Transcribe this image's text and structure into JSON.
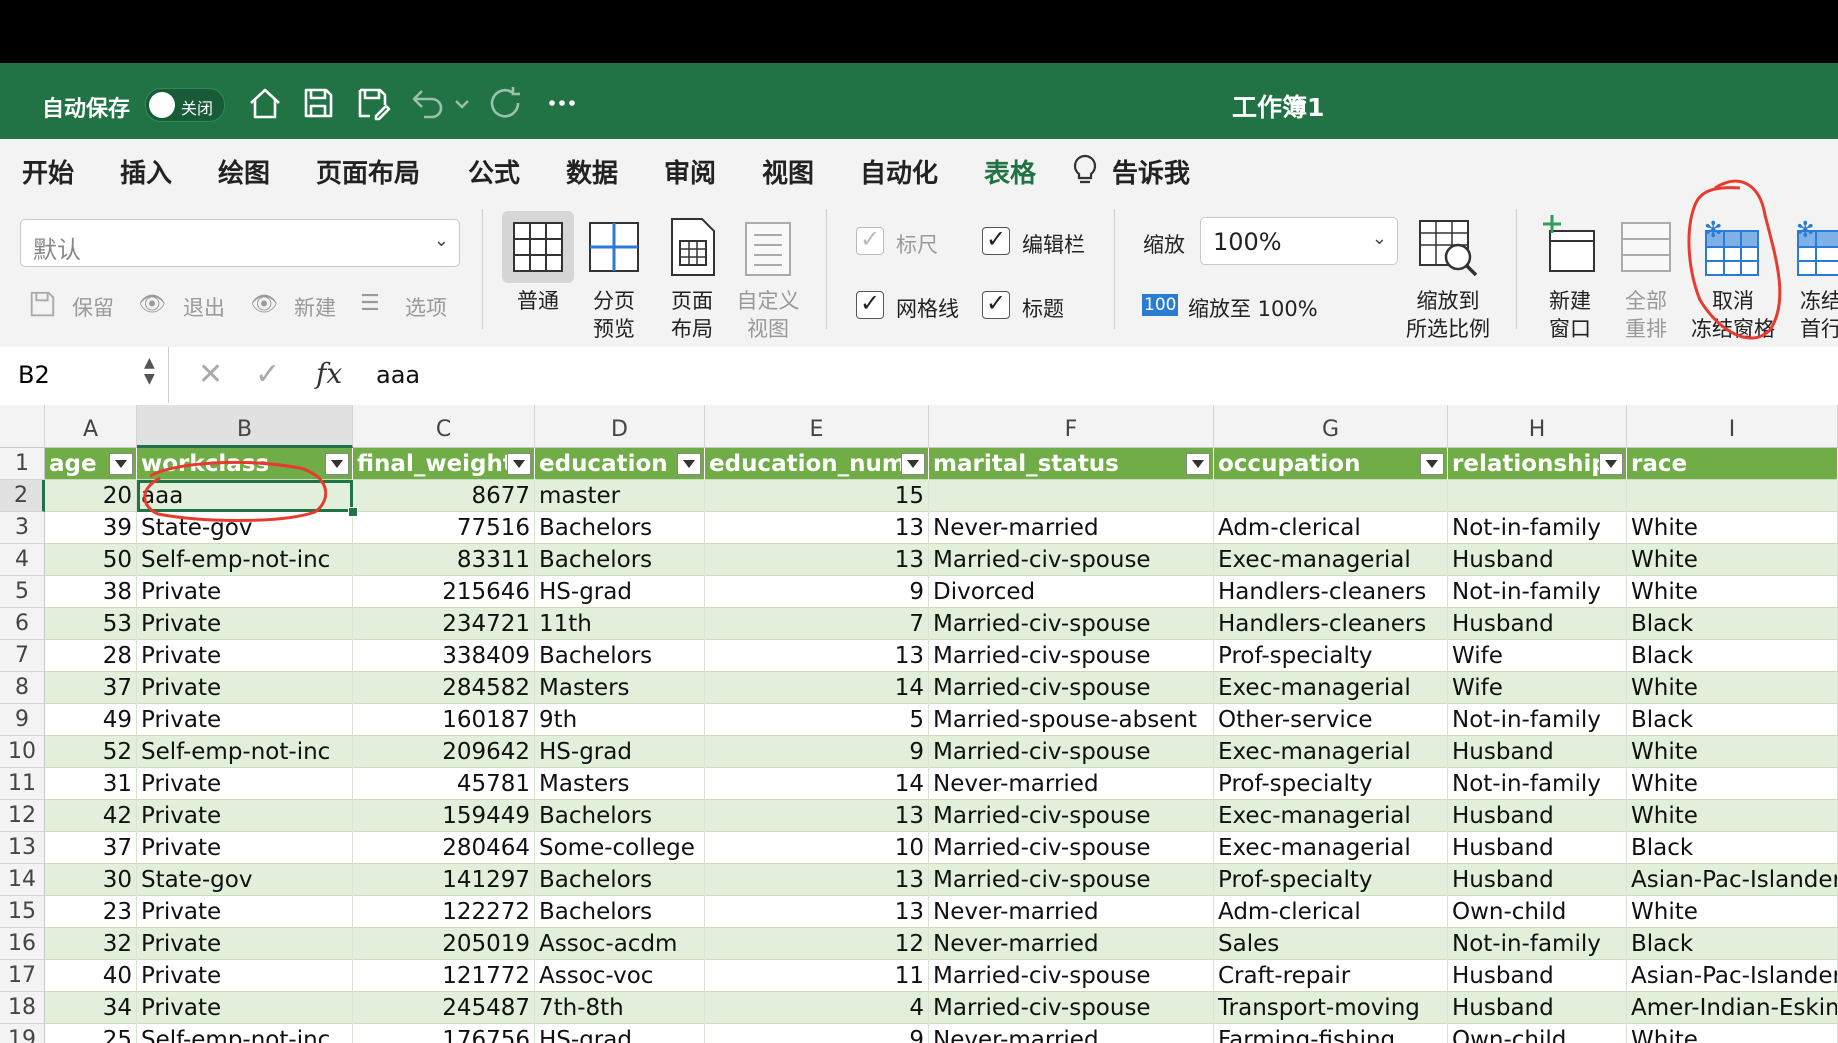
{
  "titlebar": {
    "autosave_label": "自动保存",
    "autosave_state": "关闭",
    "doc_title": "工作簿1"
  },
  "tabs": [
    {
      "label": "开始",
      "active": false
    },
    {
      "label": "插入",
      "active": false
    },
    {
      "label": "绘图",
      "active": false
    },
    {
      "label": "页面布局",
      "active": false
    },
    {
      "label": "公式",
      "active": false
    },
    {
      "label": "数据",
      "active": false
    },
    {
      "label": "审阅",
      "active": false
    },
    {
      "label": "视图",
      "active": true
    },
    {
      "label": "自动化",
      "active": false
    },
    {
      "label": "表格",
      "active": false
    },
    {
      "label": "告诉我",
      "active": false
    }
  ],
  "ribbon": {
    "sheet_view_value": "默认",
    "keep": "保留",
    "exit": "退出",
    "new": "新建",
    "options": "选项",
    "normal": "普通",
    "page_break_1": "分页",
    "page_break_2": "预览",
    "page_layout_1": "页面",
    "page_layout_2": "布局",
    "custom_view_1": "自定义",
    "custom_view_2": "视图",
    "ruler": "标尺",
    "formula_bar": "编辑栏",
    "gridlines": "网格线",
    "headings": "标题",
    "zoom_label": "缩放",
    "zoom_value": "100%",
    "zoom_100_icon": "100",
    "zoom_to_100": "缩放至 100%",
    "zoom_sel_1": "缩放到",
    "zoom_sel_2": "所选比例",
    "new_window_1": "新建",
    "new_window_2": "窗口",
    "arrange_1": "全部",
    "arrange_2": "重排",
    "unfreeze_1": "取消",
    "unfreeze_2": "冻结窗格",
    "freeze_top_1": "冻结",
    "freeze_top_2": "首行"
  },
  "formula_bar": {
    "name_box": "B2",
    "value": "aaa"
  },
  "columns": [
    "A",
    "B",
    "C",
    "D",
    "E",
    "F",
    "G",
    "H",
    "I"
  ],
  "header_row": [
    "age",
    "workclass",
    "final_weight",
    "education",
    "education_num",
    "marital_status",
    "occupation",
    "relationship",
    "race"
  ],
  "rows": [
    {
      "n": "2",
      "c": [
        "20",
        "aaa",
        "8677",
        "master",
        "15",
        "",
        "",
        "",
        ""
      ]
    },
    {
      "n": "3",
      "c": [
        "39",
        "State-gov",
        "77516",
        "Bachelors",
        "13",
        "Never-married",
        "Adm-clerical",
        "Not-in-family",
        "White"
      ]
    },
    {
      "n": "4",
      "c": [
        "50",
        "Self-emp-not-inc",
        "83311",
        "Bachelors",
        "13",
        "Married-civ-spouse",
        "Exec-managerial",
        "Husband",
        "White"
      ]
    },
    {
      "n": "5",
      "c": [
        "38",
        "Private",
        "215646",
        "HS-grad",
        "9",
        "Divorced",
        "Handlers-cleaners",
        "Not-in-family",
        "White"
      ]
    },
    {
      "n": "6",
      "c": [
        "53",
        "Private",
        "234721",
        "11th",
        "7",
        "Married-civ-spouse",
        "Handlers-cleaners",
        "Husband",
        "Black"
      ]
    },
    {
      "n": "7",
      "c": [
        "28",
        "Private",
        "338409",
        "Bachelors",
        "13",
        "Married-civ-spouse",
        "Prof-specialty",
        "Wife",
        "Black"
      ]
    },
    {
      "n": "8",
      "c": [
        "37",
        "Private",
        "284582",
        "Masters",
        "14",
        "Married-civ-spouse",
        "Exec-managerial",
        "Wife",
        "White"
      ]
    },
    {
      "n": "9",
      "c": [
        "49",
        "Private",
        "160187",
        "9th",
        "5",
        "Married-spouse-absent",
        "Other-service",
        "Not-in-family",
        "Black"
      ]
    },
    {
      "n": "10",
      "c": [
        "52",
        "Self-emp-not-inc",
        "209642",
        "HS-grad",
        "9",
        "Married-civ-spouse",
        "Exec-managerial",
        "Husband",
        "White"
      ]
    },
    {
      "n": "11",
      "c": [
        "31",
        "Private",
        "45781",
        "Masters",
        "14",
        "Never-married",
        "Prof-specialty",
        "Not-in-family",
        "White"
      ]
    },
    {
      "n": "12",
      "c": [
        "42",
        "Private",
        "159449",
        "Bachelors",
        "13",
        "Married-civ-spouse",
        "Exec-managerial",
        "Husband",
        "White"
      ]
    },
    {
      "n": "13",
      "c": [
        "37",
        "Private",
        "280464",
        "Some-college",
        "10",
        "Married-civ-spouse",
        "Exec-managerial",
        "Husband",
        "Black"
      ]
    },
    {
      "n": "14",
      "c": [
        "30",
        "State-gov",
        "141297",
        "Bachelors",
        "13",
        "Married-civ-spouse",
        "Prof-specialty",
        "Husband",
        "Asian-Pac-Islander"
      ]
    },
    {
      "n": "15",
      "c": [
        "23",
        "Private",
        "122272",
        "Bachelors",
        "13",
        "Never-married",
        "Adm-clerical",
        "Own-child",
        "White"
      ]
    },
    {
      "n": "16",
      "c": [
        "32",
        "Private",
        "205019",
        "Assoc-acdm",
        "12",
        "Never-married",
        "Sales",
        "Not-in-family",
        "Black"
      ]
    },
    {
      "n": "17",
      "c": [
        "40",
        "Private",
        "121772",
        "Assoc-voc",
        "11",
        "Married-civ-spouse",
        "Craft-repair",
        "Husband",
        "Asian-Pac-Islander"
      ]
    },
    {
      "n": "18",
      "c": [
        "34",
        "Private",
        "245487",
        "7th-8th",
        "4",
        "Married-civ-spouse",
        "Transport-moving",
        "Husband",
        "Amer-Indian-Eskimo"
      ]
    },
    {
      "n": "19",
      "c": [
        "25",
        "Self-emp-not-inc",
        "176756",
        "HS-grad",
        "9",
        "Never-married",
        "Farming-fishing",
        "Own-child",
        "White"
      ]
    }
  ],
  "numeric_columns": [
    0,
    2,
    4
  ],
  "colors": {
    "accent": "#217346",
    "table_header": "#70ad47",
    "band_light": "#e2efda",
    "annotation": "#e63b2e"
  }
}
